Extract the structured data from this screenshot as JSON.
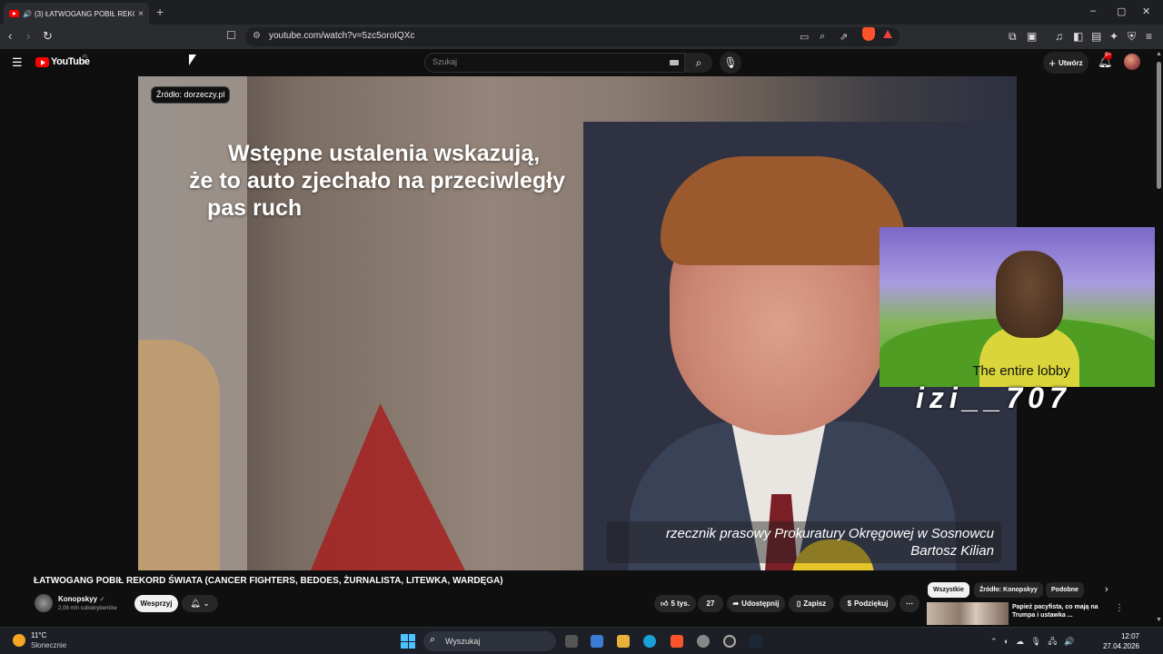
{
  "browser": {
    "tab_title": "(3) ŁATWOGANG POBIŁ REKO",
    "url": "youtube.com/watch?v=5zc5oroIQXc"
  },
  "youtube": {
    "logo_text": "YouTube",
    "region": "PL",
    "search_placeholder": "Szukaj",
    "create_label": "Utwórz",
    "notification_count": "9+"
  },
  "video": {
    "source_badge": "Źródło: dorzeczy.pl",
    "caption_lines": [
      "Wstępne ustalenia wskazują,",
      "że to auto zjechało na przeciwległy",
      "pas ruch"
    ],
    "nameplate_lines": [
      "rzecznik prasowy Prokuratury Okręgowej w Sosnowcu",
      "Bartosz Kilian"
    ],
    "overlay_caption": "The entire lobby",
    "overlay_username": "izi__707"
  },
  "details": {
    "title": "ŁATWOGANG POBIŁ REKORD ŚWIATA (CANCER FIGHTERS, BEDOES, ŻURNALISTA, LITEWKA, WARDĘGA)",
    "channel_name": "Konopskyy",
    "subscribers": "2,08 mln subskrybentów",
    "join_label": "Wesprzyj",
    "likes": "5 tys.",
    "dislikes": "27",
    "share_label": "Udostępnij",
    "save_label": "Zapisz",
    "thanks_label": "Podziękuj"
  },
  "chips": [
    "Wszystkie",
    "Źródło: Konopskyy",
    "Podobne"
  ],
  "related": {
    "title": "Papież pacyfista, co mają na Trumpa i ustawka ..."
  },
  "taskbar": {
    "temperature": "11°C",
    "condition": "Słonecznie",
    "search_label": "Wyszukaj",
    "time": "12:07",
    "date": "27.04.2026"
  }
}
